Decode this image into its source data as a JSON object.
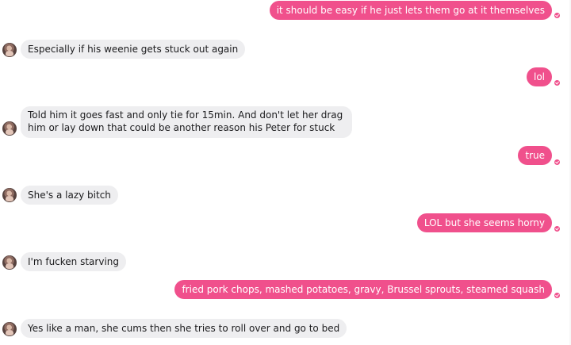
{
  "colors": {
    "outgoing_bubble": "#f0508c",
    "incoming_bubble": "#eeeef0",
    "background": "#ffffff"
  },
  "messages": [
    {
      "from": "me",
      "text": "it should be easy if he just lets them go at it themselves"
    },
    {
      "from": "them",
      "text": "Especially if his weenie gets stuck out again"
    },
    {
      "from": "me",
      "text": "lol"
    },
    {
      "from": "them",
      "text": "Told him it goes fast and only tie for 15min. And don't let her drag him or lay down that could be another reason his Peter for stuck"
    },
    {
      "from": "me",
      "text": "true"
    },
    {
      "from": "them",
      "text": "She's a lazy bitch"
    },
    {
      "from": "me",
      "text": "LOL but she seems horny"
    },
    {
      "from": "them",
      "text": "I'm fucken starving"
    },
    {
      "from": "me",
      "text": "fried pork chops, mashed potatoes, gravy, Brussel sprouts, steamed squash"
    },
    {
      "from": "them",
      "text": "Yes like a man, she cums then she tries to roll over and go to bed"
    }
  ]
}
